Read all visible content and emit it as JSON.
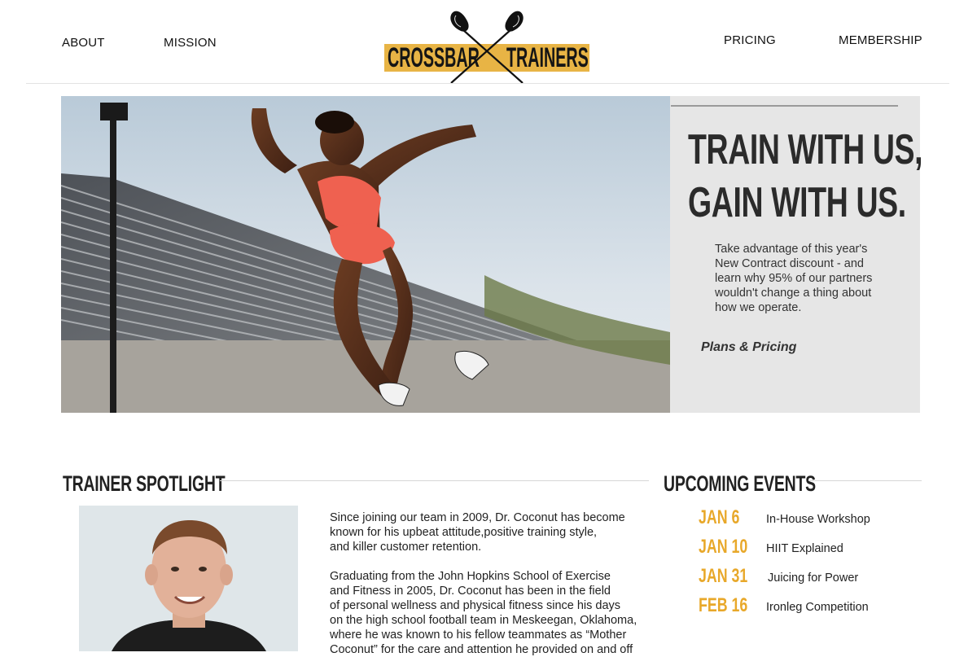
{
  "nav": {
    "about": "ABOUT",
    "mission": "MISSION",
    "pricing": "PRICING",
    "membership": "MEMBERSHIP"
  },
  "logo": {
    "left_word": "CROSSBAR",
    "right_word": "TRAINERS",
    "band_color": "#e8b445"
  },
  "hero": {
    "headline_line1": "TRAIN WITH US,",
    "headline_line2": "GAIN WITH US.",
    "body_lines": [
      "Take advantage of this year's",
      "New Contract discount - and",
      "learn why 95% of our partners",
      "wouldn't change a thing about",
      "how we operate."
    ],
    "cta": "Plans & Pricing"
  },
  "spotlight": {
    "title": "TRAINER SPOTLIGHT",
    "para1": [
      "Since joining our team in 2009, Dr. Coconut has become",
      "known for his upbeat attitude,positive training style,",
      "and killer customer retention."
    ],
    "para2": [
      "Graduating from the John Hopkins School of Exercise",
      "and Fitness in 2005, Dr. Coconut has been in the field",
      "of personal wellness and physical fitness since his days",
      "on the high school football team in Meskeegan, Oklahoma,",
      "where he was known to his fellow teammates as “Mother",
      "Coconut” for the care and attention he provided on and off"
    ]
  },
  "events": {
    "title": "UPCOMING EVENTS",
    "accent_color": "#e8a82a",
    "items": [
      {
        "date": "JAN 6",
        "name": "In-House Workshop"
      },
      {
        "date": "JAN 10",
        "name": "HIIT Explained"
      },
      {
        "date": "JAN 31",
        "name": "Juicing for Power"
      },
      {
        "date": "FEB 16",
        "name": "Ironleg Competition"
      }
    ]
  }
}
